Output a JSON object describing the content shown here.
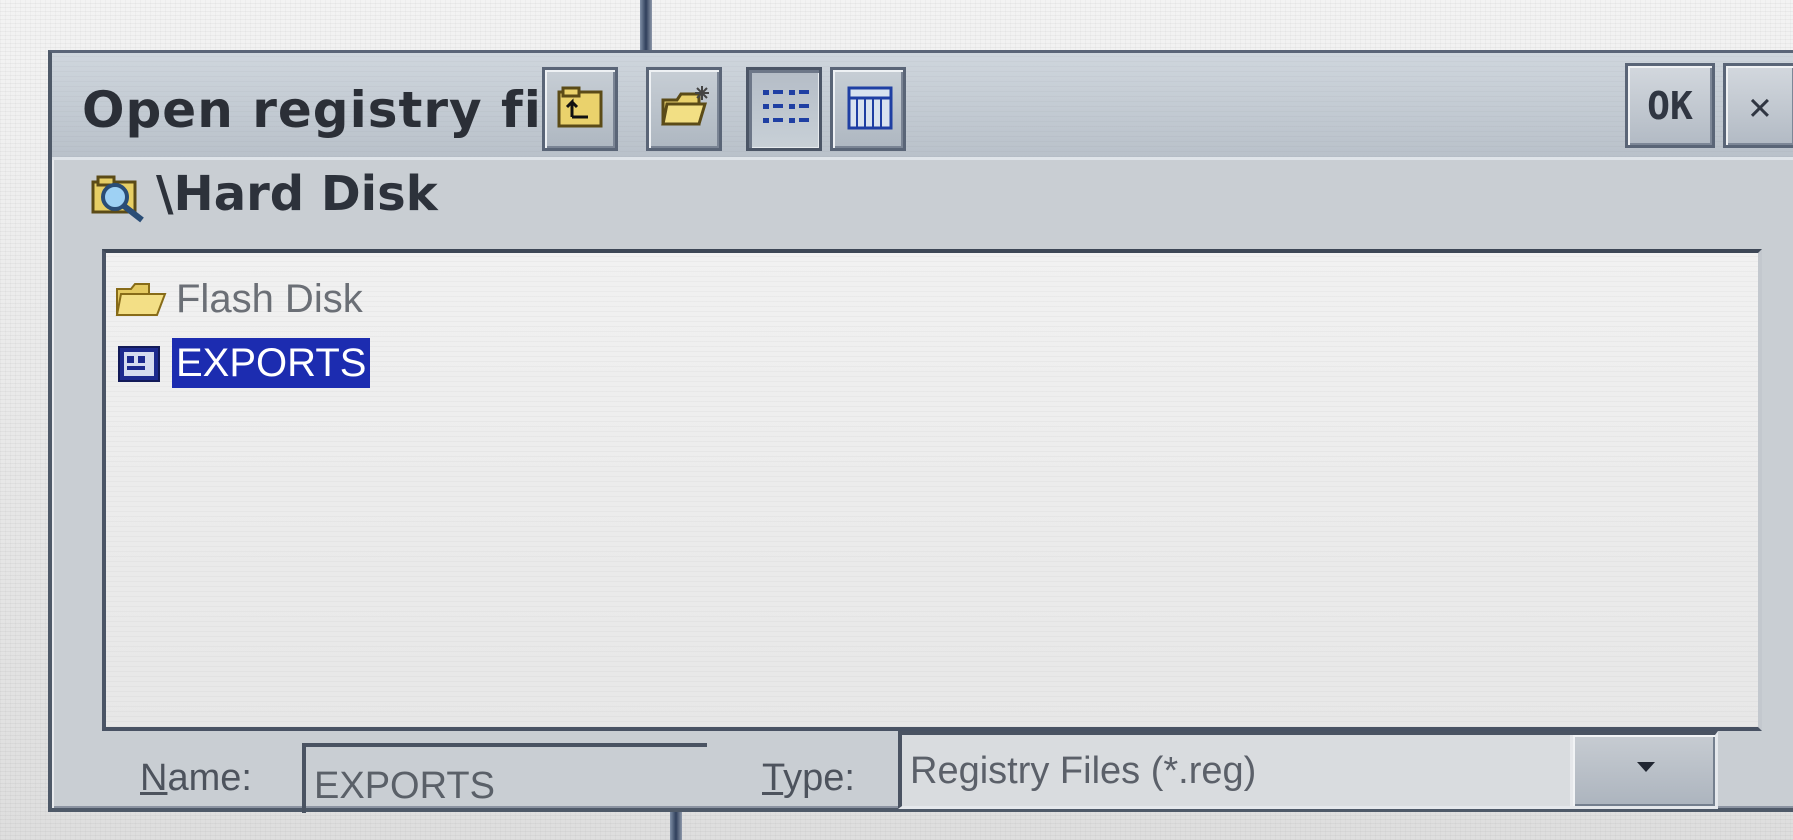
{
  "dialog": {
    "title": "Open registry file",
    "current_path": "\\Hard Disk",
    "ok_label": "OK",
    "close_label": "✕"
  },
  "toolbar": {
    "buttons": [
      {
        "name": "up-one-level",
        "icon": "folder-up-icon"
      },
      {
        "name": "new-folder",
        "icon": "new-folder-icon"
      },
      {
        "name": "list-view",
        "icon": "list-view-icon",
        "active": true
      },
      {
        "name": "details-view",
        "icon": "details-view-icon"
      }
    ]
  },
  "file_list": {
    "items": [
      {
        "label": "Flash Disk",
        "icon": "folder-icon",
        "selected": false
      },
      {
        "label": "EXPORTS",
        "icon": "registry-file-icon",
        "selected": true
      }
    ]
  },
  "footer": {
    "name_label_prefix": "",
    "name_label_underlined": "N",
    "name_label_rest": "ame:",
    "name_value": "EXPORTS",
    "type_label_underlined": "T",
    "type_label_rest": "ype:",
    "type_value": "Registry Files (*.reg)"
  },
  "colors": {
    "selection": "#1c2cb0",
    "dialog_frame": "#4e5968",
    "title_text": "#2b2f37"
  }
}
